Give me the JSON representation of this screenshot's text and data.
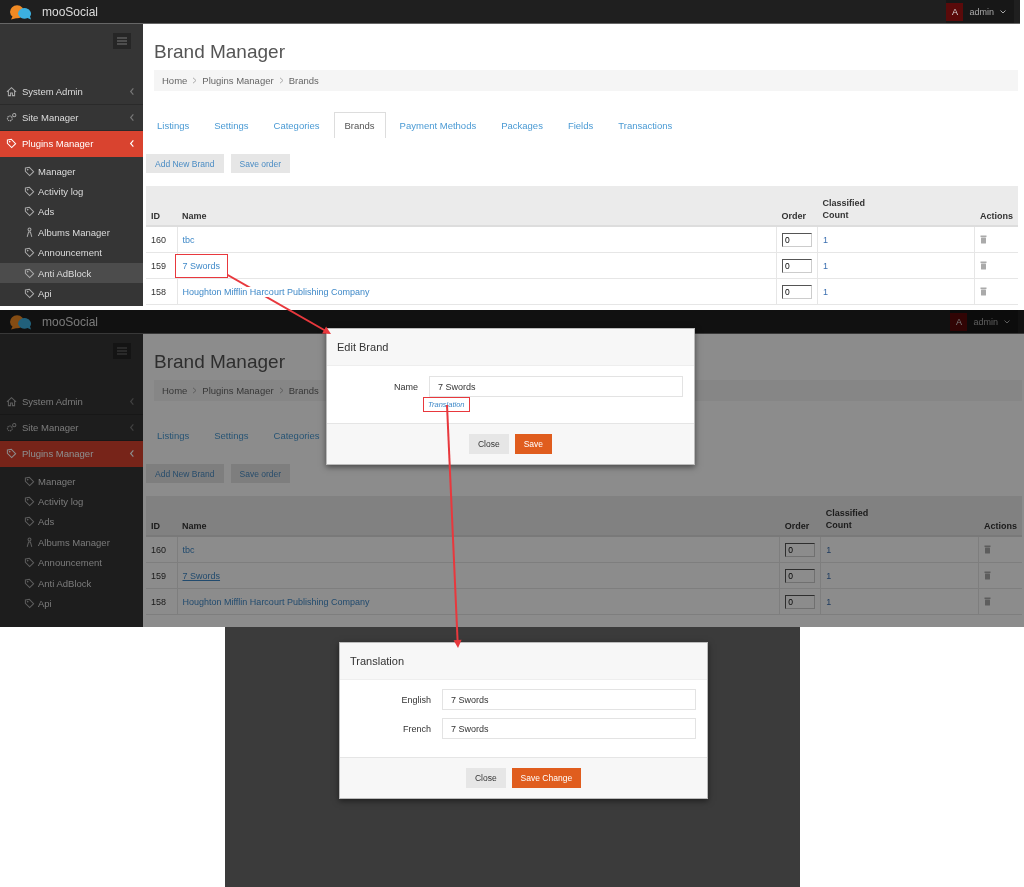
{
  "screen_1": {
    "brand": "mooSocial",
    "user": {
      "initial": "A",
      "name": "admin"
    },
    "sidebar": [
      {
        "label": "System Admin",
        "kind": "home",
        "selected": false
      },
      {
        "label": "Site Manager",
        "kind": "gears",
        "selected": false
      },
      {
        "label": "Plugins Manager",
        "kind": "tag",
        "selected": true,
        "children": [
          {
            "label": "Manager",
            "kind": "tag",
            "selected": false
          },
          {
            "label": "Activity log",
            "kind": "tag",
            "selected": false
          },
          {
            "label": "Ads",
            "kind": "tag",
            "selected": false
          },
          {
            "label": "Albums Manager",
            "kind": "figure",
            "selected": false
          },
          {
            "label": "Announcement",
            "kind": "tag",
            "selected": false
          },
          {
            "label": "Anti AdBlock",
            "kind": "tag",
            "selected": true
          },
          {
            "label": "Api",
            "kind": "tag",
            "selected": false
          }
        ]
      }
    ],
    "title": "Brand Manager",
    "breadcrumb": [
      "Home",
      "Plugins Manager",
      "Brands"
    ],
    "tabs": [
      {
        "label": "Listings",
        "selected": false
      },
      {
        "label": "Settings",
        "selected": false
      },
      {
        "label": "Categories",
        "selected": false
      },
      {
        "label": "Brands",
        "selected": true
      },
      {
        "label": "Payment Methods",
        "selected": false
      },
      {
        "label": "Packages",
        "selected": false
      },
      {
        "label": "Fields",
        "selected": false
      },
      {
        "label": "Transactions",
        "selected": false
      }
    ],
    "buttons": [
      "Add New Brand",
      "Save order"
    ],
    "table": {
      "columns": [
        "ID",
        "Name",
        "Order",
        "Classified Count",
        "Actions"
      ],
      "rows": [
        {
          "id": "160",
          "name": "tbc",
          "order": "0",
          "count": "1",
          "highlighted": false,
          "hovered": false
        },
        {
          "id": "159",
          "name": "7 Swords",
          "order": "0",
          "count": "1",
          "highlighted": true,
          "hovered": false
        },
        {
          "id": "158",
          "name": "Houghton Mifflin Harcourt Publishing Company",
          "order": "0",
          "count": "1",
          "highlighted": false,
          "hovered": false
        }
      ]
    }
  },
  "screen_2": {
    "background": {
      "brand": "mooSocial",
      "user": {
        "initial": "A",
        "name": "admin"
      },
      "sidebar": [
        {
          "label": "System Admin",
          "kind": "home",
          "selected": false
        },
        {
          "label": "Site Manager",
          "kind": "gears",
          "selected": false
        },
        {
          "label": "Plugins Manager",
          "kind": "tag",
          "selected": true,
          "children": [
            {
              "label": "Manager",
              "kind": "tag",
              "selected": false
            },
            {
              "label": "Activity log",
              "kind": "tag",
              "selected": false
            },
            {
              "label": "Ads",
              "kind": "tag",
              "selected": false
            },
            {
              "label": "Albums Manager",
              "kind": "figure",
              "selected": false
            },
            {
              "label": "Announcement",
              "kind": "tag",
              "selected": false
            },
            {
              "label": "Anti AdBlock",
              "kind": "tag",
              "selected": false
            },
            {
              "label": "Api",
              "kind": "tag",
              "selected": false
            }
          ]
        }
      ],
      "title": "Brand Manager",
      "breadcrumb": [
        "Home",
        "Plugins Manager",
        "Brands"
      ],
      "tabs": [
        {
          "label": "Listings",
          "selected": false
        },
        {
          "label": "Settings",
          "selected": false
        },
        {
          "label": "Categories",
          "selected": false
        }
      ],
      "buttons": [
        "Add New Brand",
        "Save order"
      ],
      "table": {
        "columns": [
          "ID",
          "Name",
          "Order",
          "Classified Count",
          "Actions"
        ],
        "rows": [
          {
            "id": "160",
            "name": "tbc",
            "order": "0",
            "count": "1",
            "highlighted": false,
            "hovered": false
          },
          {
            "id": "159",
            "name": "7 Swords",
            "order": "0",
            "count": "1",
            "highlighted": false,
            "hovered": true
          },
          {
            "id": "158",
            "name": "Houghton Mifflin Harcourt Publishing Company",
            "order": "0",
            "count": "1",
            "highlighted": false,
            "hovered": false
          }
        ]
      }
    },
    "dialog": {
      "title": "Edit Brand",
      "fields": [
        {
          "label": "Name",
          "value": "7 Swords"
        }
      ],
      "link": {
        "text": "Translation",
        "highlighted": true
      },
      "buttons": [
        {
          "label": "Close",
          "kind": "secondary"
        },
        {
          "label": "Save",
          "kind": "primary"
        }
      ]
    }
  },
  "screen_3": {
    "dialog": {
      "title": "Translation",
      "fields": [
        {
          "label": "English",
          "value": "7 Swords"
        },
        {
          "label": "French",
          "value": "7 Swords"
        }
      ],
      "buttons": [
        {
          "label": "Close",
          "kind": "secondary"
        },
        {
          "label": "Save Change",
          "kind": "primary"
        }
      ]
    }
  }
}
